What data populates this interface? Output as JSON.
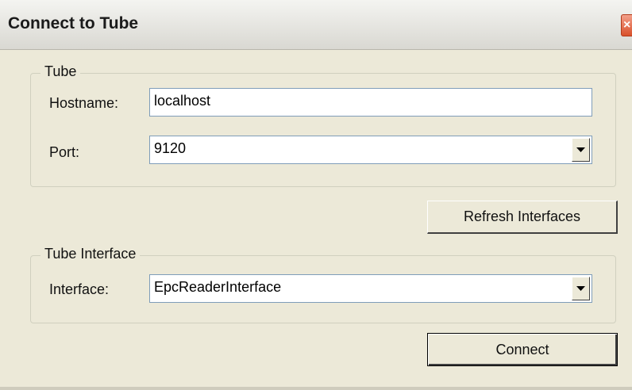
{
  "window": {
    "title": "Connect to Tube",
    "close_glyph": "×"
  },
  "tube_group": {
    "legend": "Tube",
    "hostname_label": "Hostname:",
    "hostname_value": "localhost",
    "port_label": "Port:",
    "port_value": "9120"
  },
  "refresh_button": {
    "label": "Refresh Interfaces"
  },
  "interface_group": {
    "legend": "Tube Interface",
    "interface_label": "Interface:",
    "interface_value": "EpcReaderInterface"
  },
  "connect_button": {
    "label": "Connect"
  },
  "icons": {
    "close": "close-icon",
    "dropdown": "chevron-down-icon"
  }
}
